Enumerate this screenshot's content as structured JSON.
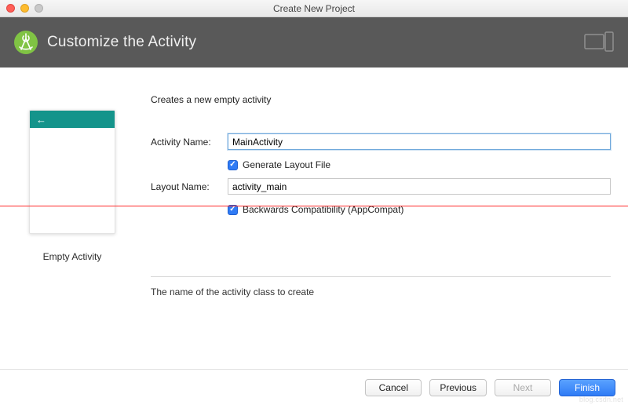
{
  "window_title": "Create New Project",
  "banner": {
    "heading": "Customize the Activity"
  },
  "subtitle": "Creates a new empty activity",
  "preview": {
    "caption": "Empty Activity"
  },
  "form": {
    "activity_name_label": "Activity Name:",
    "activity_name_value": "MainActivity",
    "generate_layout_label": "Generate Layout File",
    "layout_name_label": "Layout Name:",
    "layout_name_value": "activity_main",
    "back_compat_label": "Backwards Compatibility (AppCompat)"
  },
  "hint": "The name of the activity class to create",
  "footer": {
    "cancel": "Cancel",
    "previous": "Previous",
    "next": "Next",
    "finish": "Finish"
  }
}
